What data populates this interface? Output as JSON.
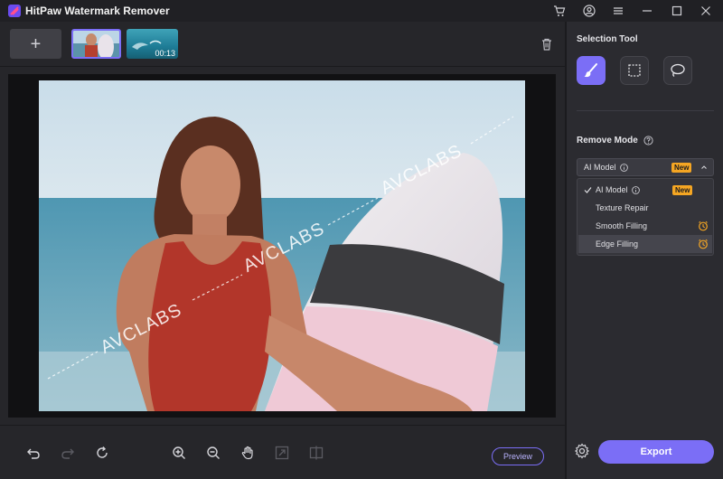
{
  "app": {
    "title": "HitPaw Watermark Remover",
    "accent": "#7b6ef6",
    "window_icons": [
      "cart-icon",
      "account-icon",
      "menu-icon",
      "minimize-icon",
      "maximize-icon",
      "close-icon"
    ]
  },
  "media": {
    "add_label": "+",
    "thumbnails": [
      {
        "name": "photo-thumbnail",
        "selected": true
      },
      {
        "name": "video-thumbnail",
        "duration": "00:13",
        "selected": false
      }
    ]
  },
  "canvas": {
    "watermarks": [
      "AVCLABS",
      "AVCLABS",
      "AVCLABS"
    ]
  },
  "toolbar": {
    "tools": [
      "undo-icon",
      "redo-icon",
      "reset-icon",
      "zoom-in-icon",
      "zoom-out-icon",
      "hand-icon",
      "fit-icon",
      "compare-icon"
    ],
    "preview_label": "Preview"
  },
  "panel": {
    "selection_tool_heading": "Selection Tool",
    "selection_tools": [
      {
        "name": "brush-tool",
        "active": true
      },
      {
        "name": "rectangle-tool",
        "active": false
      },
      {
        "name": "lasso-tool",
        "active": false
      }
    ],
    "remove_mode_heading": "Remove Mode",
    "selected_mode": "AI Model",
    "new_badge": "New",
    "modes": [
      {
        "label": "AI Model",
        "checked": true,
        "badge": "New"
      },
      {
        "label": "Texture Repair",
        "checked": false
      },
      {
        "label": "Smooth Filling",
        "checked": false,
        "premium": true
      },
      {
        "label": "Edge Filling",
        "checked": false,
        "premium": true,
        "hovered": true
      }
    ],
    "export_label": "Export",
    "badge_color": "#f5a623"
  }
}
